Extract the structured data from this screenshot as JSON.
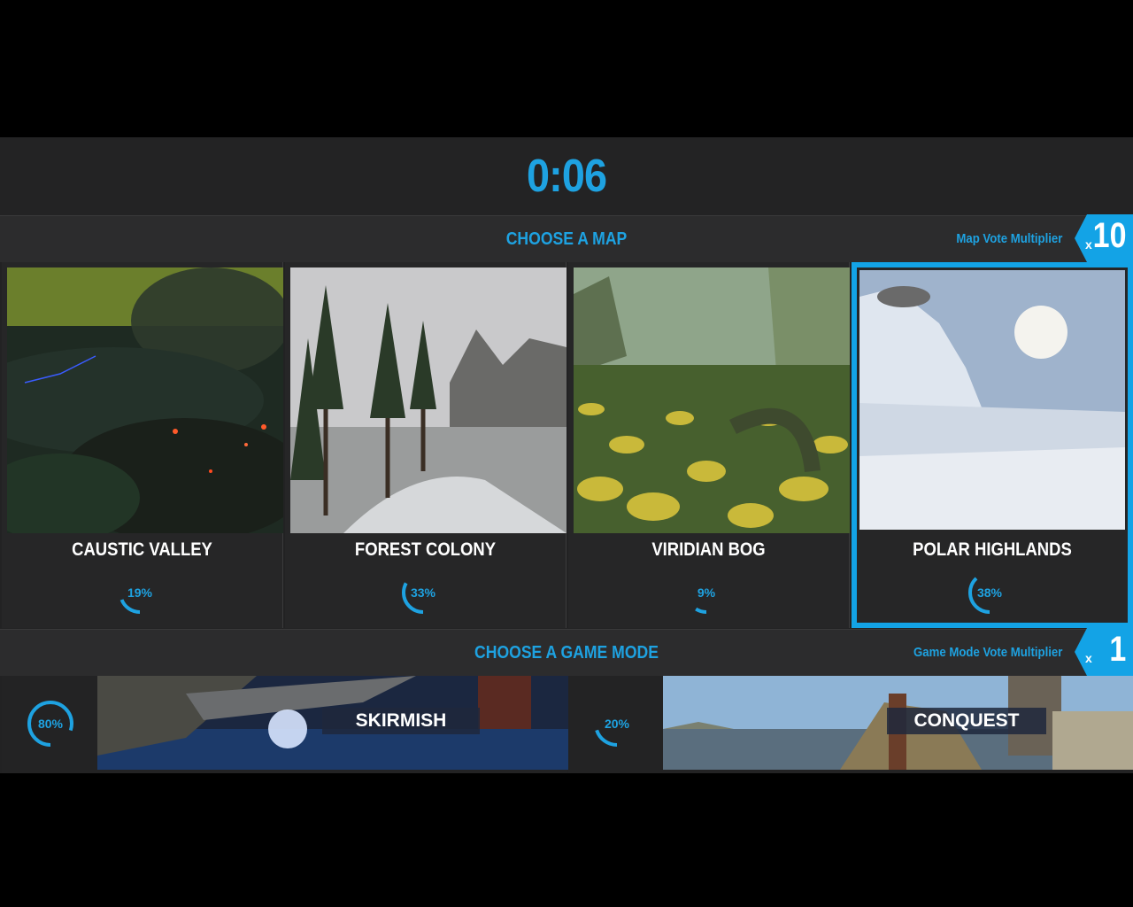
{
  "timer": "0:06",
  "map_section": {
    "title": "CHOOSE A MAP",
    "multiplier_label": "Map Vote Multiplier",
    "multiplier_prefix": "x",
    "multiplier_value": "10"
  },
  "maps": [
    {
      "name": "CAUSTIC VALLEY",
      "percent_text": "19%",
      "percent": 19,
      "selected": false
    },
    {
      "name": "FOREST COLONY",
      "percent_text": "33%",
      "percent": 33,
      "selected": false
    },
    {
      "name": "VIRIDIAN BOG",
      "percent_text": "9%",
      "percent": 9,
      "selected": false
    },
    {
      "name": "POLAR HIGHLANDS",
      "percent_text": "38%",
      "percent": 38,
      "selected": true
    }
  ],
  "mode_section": {
    "title": "CHOOSE A GAME MODE",
    "multiplier_label": "Game Mode Vote Multiplier",
    "multiplier_prefix": "x",
    "multiplier_value": "1"
  },
  "modes": [
    {
      "name": "SKIRMISH",
      "percent_text": "80%",
      "percent": 80
    },
    {
      "name": "CONQUEST",
      "percent_text": "20%",
      "percent": 20
    }
  ],
  "colors": {
    "accent": "#1ea2e1",
    "selected_border": "#13a3e6"
  }
}
